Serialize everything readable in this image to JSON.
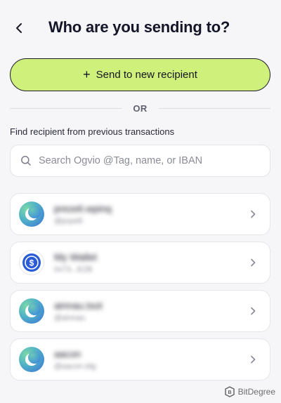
{
  "header": {
    "title": "Who are you sending to?",
    "back_icon": "chevron-left-icon"
  },
  "send_new": {
    "label": "Send to new recipient",
    "icon": "plus-icon",
    "accent": "#cff17c"
  },
  "divider": {
    "label": "OR"
  },
  "find": {
    "label": "Find recipient from previous transactions",
    "placeholder": "Search Ogvio @Tag, name, or IBAN"
  },
  "recipients": [
    {
      "name": "prezeli.wpinq",
      "sub": "@prpeili",
      "avatar": "ogvio-logo"
    },
    {
      "name": "My Wallet",
      "sub": "0x73...EZB",
      "avatar": "usdc-coin-icon"
    },
    {
      "name": "ainnau.tsot",
      "sub": "@ainnau",
      "avatar": "ogvio-logo"
    },
    {
      "name": "aacon",
      "sub": "@aacon.tdg",
      "avatar": "ogvio-logo"
    }
  ],
  "watermark": {
    "text": "BitDegree"
  }
}
